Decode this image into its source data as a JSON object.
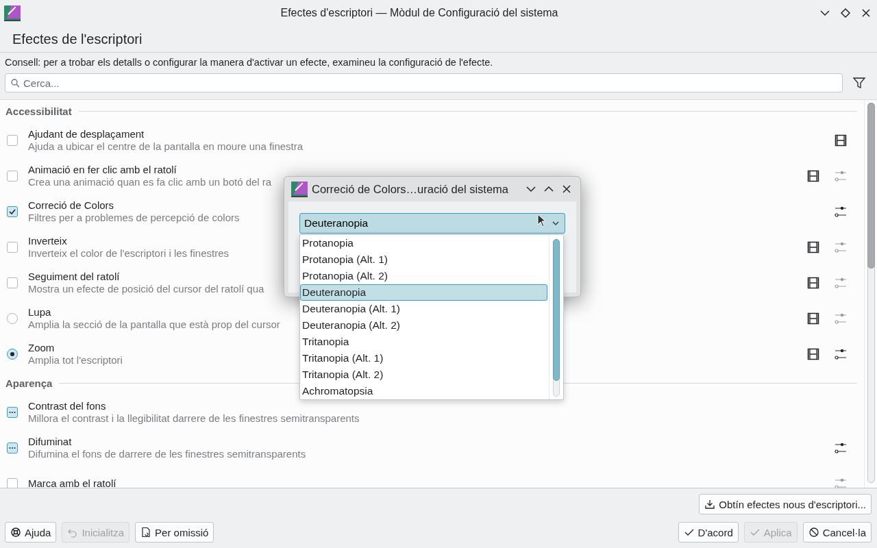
{
  "window": {
    "title": "Efectes d'escriptori — Mòdul de Configuració del sistema"
  },
  "page_title": "Efectes de l'escriptori",
  "hint": "Consell: per a trobar els detalls o configurar la manera d'activar un efecte, examineu la configuració de l'efecte.",
  "search": {
    "placeholder": "Cerca..."
  },
  "sections": [
    {
      "title": "Accessibilitat",
      "effects": [
        {
          "name": "Ajudant de desplaçament",
          "description": "Ajuda a ubicar el centre de la pantalla en moure una finestra",
          "control": {
            "kind": "checkbox",
            "checked": false
          },
          "buttons": [
            {
              "kind": "video"
            }
          ]
        },
        {
          "name": "Animació en fer clic amb el ratolí",
          "description": "Crea una animació quan es fa clic amb un botó del ra",
          "control": {
            "kind": "checkbox",
            "checked": false
          },
          "buttons": [
            {
              "kind": "video"
            },
            {
              "kind": "configure",
              "disabled": true
            }
          ]
        },
        {
          "name": "Correció de Colors",
          "description": "Filtres per a problemes de percepció de colors",
          "control": {
            "kind": "checkbox",
            "checked": true
          },
          "buttons": [
            {
              "kind": "configure",
              "disabled": false
            }
          ]
        },
        {
          "name": "Inverteix",
          "description": "Inverteix el color de l'escriptori i les finestres",
          "control": {
            "kind": "checkbox",
            "checked": false
          },
          "buttons": [
            {
              "kind": "video"
            },
            {
              "kind": "configure",
              "disabled": true
            }
          ]
        },
        {
          "name": "Seguiment del ratolí",
          "description": "Mostra un efecte de posició del cursor del ratolí qua",
          "control": {
            "kind": "checkbox",
            "checked": false
          },
          "buttons": [
            {
              "kind": "video"
            },
            {
              "kind": "configure",
              "disabled": true
            }
          ]
        },
        {
          "name": "Lupa",
          "description": "Amplia la secció de la pantalla que està prop del cursor",
          "control": {
            "kind": "radio",
            "selected": false
          },
          "buttons": [
            {
              "kind": "video"
            },
            {
              "kind": "configure",
              "disabled": true
            }
          ]
        },
        {
          "name": "Zoom",
          "description": "Amplia tot l'escriptori",
          "control": {
            "kind": "radio",
            "selected": true
          },
          "buttons": [
            {
              "kind": "video"
            },
            {
              "kind": "configure",
              "disabled": false
            }
          ]
        }
      ]
    },
    {
      "title": "Aparença",
      "effects": [
        {
          "name": "Contrast del fons",
          "description": "Millora el contrast i la llegibilitat darrere de les finestres semitransparents",
          "control": {
            "kind": "tristate",
            "partial": true
          }
        },
        {
          "name": "Difuminat",
          "description": "Difumina el fons de darrere de les finestres semitransparents",
          "control": {
            "kind": "tristate",
            "partial": true
          },
          "buttons": [
            {
              "kind": "configure",
              "disabled": false
            }
          ]
        },
        {
          "name": "Marca amb el ratolí",
          "control": {
            "kind": "checkbox",
            "checked": false
          },
          "buttons": [
            {
              "kind": "configure",
              "disabled": true
            }
          ]
        }
      ]
    }
  ],
  "get_new_button": "Obtín efectes nous d'escriptori...",
  "footer_left": [
    {
      "label": "Ajuda",
      "disabled": false
    },
    {
      "label": "Inicialitza",
      "disabled": true
    },
    {
      "label": "Per omissió",
      "disabled": false
    }
  ],
  "footer_right": [
    {
      "label": "D'acord",
      "disabled": false
    },
    {
      "label": "Aplica",
      "disabled": true
    },
    {
      "label": "Cancel·la",
      "disabled": false
    }
  ],
  "dialog": {
    "title": "Correció de Colors…uració del sistema",
    "combo": {
      "value": "Deuteranopia",
      "options": [
        {
          "label": "Protanopia",
          "selected": false
        },
        {
          "label": "Protanopia (Alt. 1)",
          "selected": false
        },
        {
          "label": "Protanopia (Alt. 2)",
          "selected": false
        },
        {
          "label": "Deuteranopia",
          "selected": true
        },
        {
          "label": "Deuteranopia (Alt. 1)",
          "selected": false
        },
        {
          "label": "Deuteranopia (Alt. 2)",
          "selected": false
        },
        {
          "label": "Tritanopia",
          "selected": false
        },
        {
          "label": "Tritanopia (Alt. 1)",
          "selected": false
        },
        {
          "label": "Tritanopia (Alt. 2)",
          "selected": false
        },
        {
          "label": "Achromatopsia",
          "selected": false
        }
      ]
    }
  }
}
